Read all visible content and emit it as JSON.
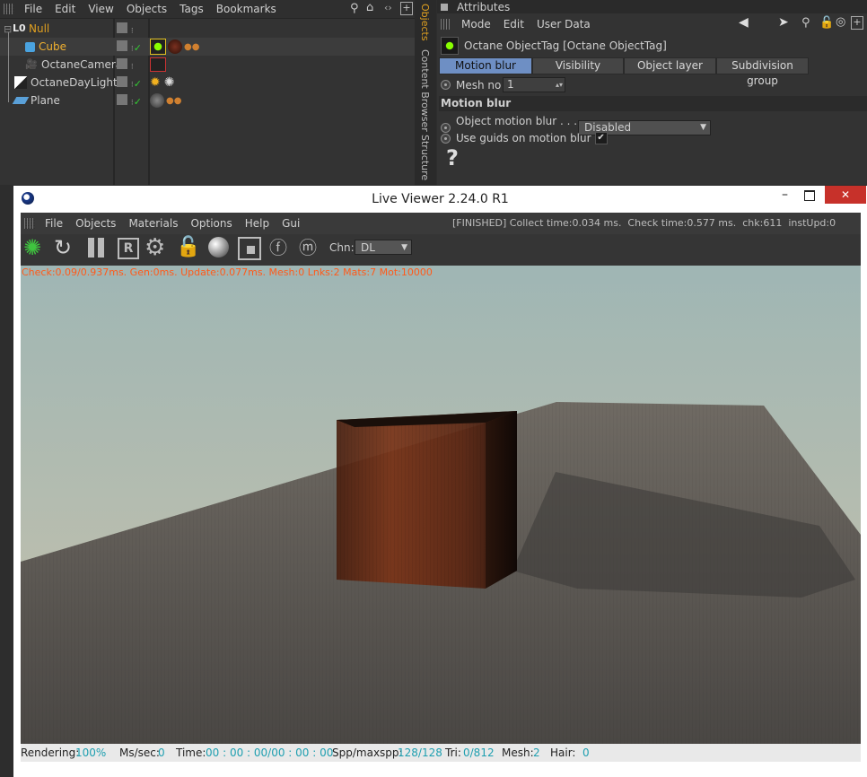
{
  "object_manager": {
    "menu": [
      "File",
      "Edit",
      "View",
      "Objects",
      "Tags",
      "Bookmarks"
    ],
    "objects": [
      {
        "name": "Null",
        "color": "#e0a020"
      },
      {
        "name": "Cube",
        "color": "#f0b030"
      },
      {
        "name": "OctaneCamera",
        "color": "#cfcfcf"
      },
      {
        "name": "OctaneDayLight",
        "color": "#cfcfcf"
      },
      {
        "name": "Plane",
        "color": "#cfcfcf"
      }
    ],
    "side_tabs": [
      "Objects",
      "Content Browser",
      "Structure"
    ]
  },
  "attributes": {
    "title": "Attributes",
    "menu": [
      "Mode",
      "Edit",
      "User Data"
    ],
    "object_title": "Octane ObjectTag [Octane ObjectTag]",
    "tabs": [
      "Motion blur",
      "Visibility",
      "Object layer",
      "Subdivision group"
    ],
    "active_tab": "Motion blur",
    "mesh_no_label": "Mesh no",
    "mesh_no_value": "1",
    "section_title": "Motion blur",
    "object_motion_blur_label": "Object motion blur . . . . . .",
    "object_motion_blur_value": "Disabled",
    "use_guids_label": "Use guids on motion blur",
    "use_guids_checked": "✔",
    "help_glyph": "?"
  },
  "live_viewer": {
    "title": "Live Viewer 2.24.0 R1",
    "menu": [
      "File",
      "Objects",
      "Materials",
      "Options",
      "Help",
      "Gui"
    ],
    "status_header": "[FINISHED] Collect time:0.034 ms.  Check time:0.577 ms.  chk:611  instUpd:0",
    "channel_label": "Chn:",
    "channel_value": "DL",
    "overlay_text": "Check:0.09/0.937ms. Gen:0ms. Update:0.077ms. Mesh:0 Lnks:2 Mats:7 Mot:10000",
    "status": {
      "rendering_label": "Rendering:",
      "rendering_value": "100%",
      "mssec_label": "Ms/sec:",
      "mssec_value": "0",
      "time_label": "Time:",
      "time_value": "00 : 00 : 00/00 : 00 : 00",
      "spp_label": "Spp/maxspp:",
      "spp_value": "128/128",
      "tri_label": "Tri:",
      "tri_value": "0/812",
      "mesh_label": "Mesh:",
      "mesh_value": "2",
      "hair_label": "Hair:",
      "hair_value": "0"
    },
    "window_controls": [
      "minimize",
      "maximize",
      "close"
    ]
  }
}
